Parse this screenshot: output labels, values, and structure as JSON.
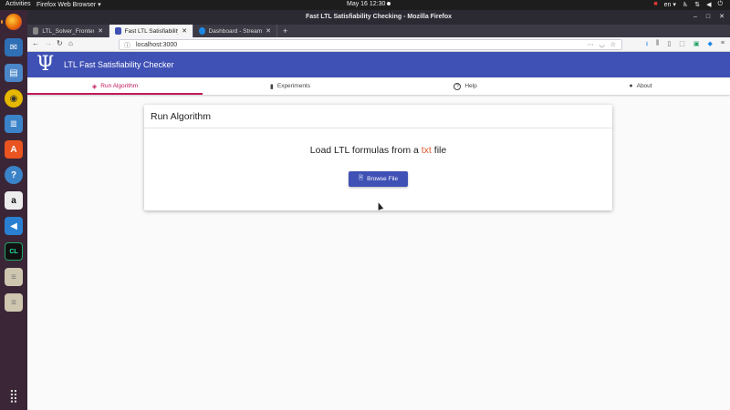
{
  "topbar": {
    "activities": "Activities",
    "app_menu": "Firefox Web Browser ▾",
    "clock": "May 16  12:30",
    "lang": "en ▾"
  },
  "dock": {
    "items": [
      {
        "icon": "firefox-icon",
        "color": "#e66000",
        "glyph": "●"
      },
      {
        "icon": "thunderbird-icon",
        "color": "#2f6fb5",
        "glyph": "✉"
      },
      {
        "icon": "files-icon",
        "color": "#4a86c8",
        "glyph": "≡"
      },
      {
        "icon": "rhythmbox-icon",
        "color": "#e6b800",
        "glyph": "◉"
      },
      {
        "icon": "libreoffice-writer-icon",
        "color": "#3b83c9",
        "glyph": "≣"
      },
      {
        "icon": "software-center-icon",
        "color": "#e95420",
        "glyph": "A"
      },
      {
        "icon": "help-icon",
        "color": "#3b83c9",
        "glyph": "?"
      },
      {
        "icon": "amazon-icon",
        "color": "#ededed",
        "glyph": "a"
      },
      {
        "icon": "vscode-icon",
        "color": "#2a7fd1",
        "glyph": "◀"
      },
      {
        "icon": "clion-icon",
        "color": "#21a366",
        "glyph": "CL"
      },
      {
        "icon": "document-icon",
        "color": "#cfc6b0",
        "glyph": "≡"
      },
      {
        "icon": "document-icon",
        "color": "#cfc6b0",
        "glyph": "≡"
      }
    ],
    "apps_grid_glyph": "⣿"
  },
  "browser": {
    "window_title": "Fast LTL Satisfiability Checking - Mozilla Firefox",
    "tabs": [
      {
        "label": "LTL_Solver_Frontend/Ex",
        "fav_color": "#888888",
        "active": false
      },
      {
        "label": "Fast LTL Satisfiability Ch",
        "fav_color": "#3f51b5",
        "active": true
      },
      {
        "label": "Dashboard - Streamable",
        "fav_color": "#1e88e5",
        "active": false
      }
    ],
    "url": "localhost:3000"
  },
  "app": {
    "title": "LTL Fast Satisfiability Checker",
    "logo": "Ψ",
    "accent": "#3f51b5",
    "tab_accent": "#c2185b",
    "tabs": [
      {
        "label": "Run Algorithm",
        "icon": "layers-icon",
        "glyph": "◈"
      },
      {
        "label": "Experiments",
        "icon": "bar-chart-icon",
        "glyph": "▮"
      },
      {
        "label": "Help",
        "icon": "help-circle-icon",
        "glyph": "?"
      },
      {
        "label": "About",
        "icon": "account-circle-icon",
        "glyph": "●"
      }
    ],
    "card": {
      "title": "Run Algorithm",
      "load_prefix": "Load LTL formulas from a ",
      "load_ext": "txt",
      "load_suffix": " file",
      "browse_label": "Browse File"
    }
  }
}
